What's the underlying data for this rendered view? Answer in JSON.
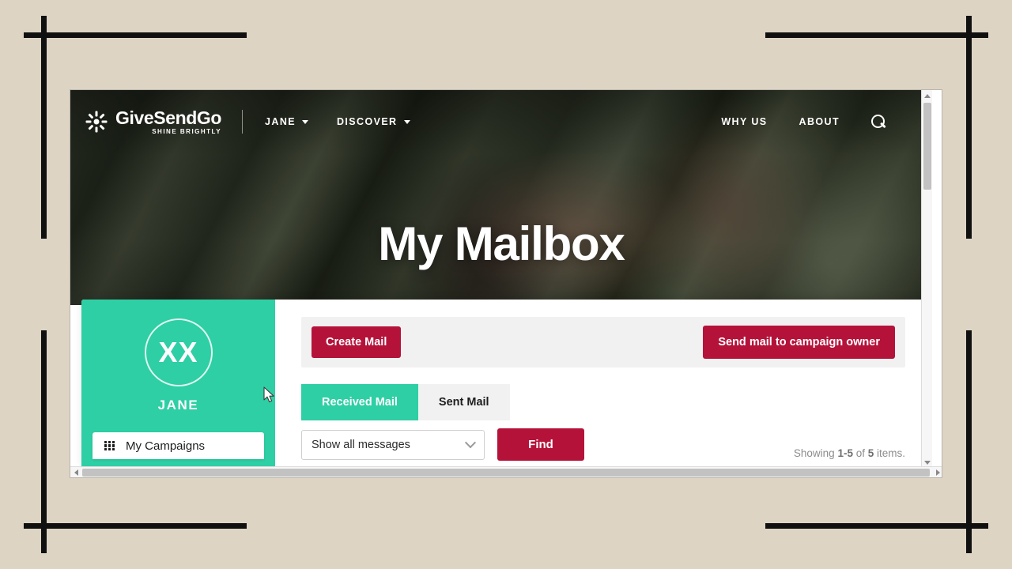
{
  "page": {
    "background_color": "#ddd4c4",
    "frame_color": "#101010",
    "accent_teal": "#2ecfa4",
    "accent_crimson": "#b5123a"
  },
  "navbar": {
    "logo_icon": "sunburst-logo-icon",
    "brand_name": "GiveSendGo",
    "brand_tagline": "SHINE BRIGHTLY",
    "left_items": [
      {
        "label": "JANE",
        "has_caret": true
      },
      {
        "label": "DISCOVER",
        "has_caret": true
      }
    ],
    "right_items": [
      {
        "label": "WHY US"
      },
      {
        "label": "ABOUT"
      }
    ],
    "search_icon": "search-icon"
  },
  "hero": {
    "title": "My Mailbox"
  },
  "sidebar": {
    "avatar_initials": "XX",
    "profile_name": "JANE",
    "menu": [
      {
        "label": "My Campaigns",
        "icon": "grid-icon"
      }
    ]
  },
  "actions": {
    "create_mail_label": "Create Mail",
    "send_mail_label": "Send mail to campaign owner"
  },
  "tabs": [
    {
      "label": "Received Mail",
      "active": true
    },
    {
      "label": "Sent Mail",
      "active": false
    }
  ],
  "filter": {
    "select_value": "Show all messages",
    "chevron_icon": "chevron-down-icon",
    "find_label": "Find",
    "showing_prefix": "Showing ",
    "showing_range": "1-5",
    "showing_middle": " of ",
    "showing_total": "5",
    "showing_suffix": " items."
  },
  "scrollbars": {
    "vertical_up_icon": "scroll-up-arrow-icon",
    "vertical_down_icon": "scroll-down-arrow-icon",
    "horizontal_left_icon": "scroll-left-arrow-icon",
    "horizontal_right_icon": "scroll-right-arrow-icon"
  }
}
